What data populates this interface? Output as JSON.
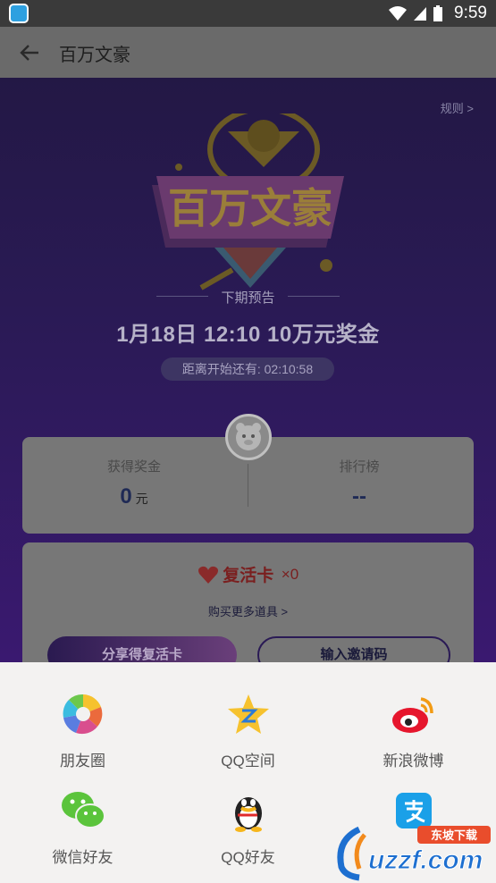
{
  "status_bar": {
    "time": "9:59",
    "icons": [
      "app-icon",
      "wifi-icon",
      "signal-icon",
      "battery-icon"
    ]
  },
  "app_bar": {
    "back_icon": "arrow-left-icon",
    "title": "百万文豪"
  },
  "hero": {
    "rules_link": "规则 >",
    "logo_text": "百万文豪",
    "next_label": "下期预告",
    "next_time": "1月18日 12:10 10万元奖金",
    "countdown": "距离开始还有: 02:10:58"
  },
  "stats": {
    "prize_label": "获得奖金",
    "prize_value": "0",
    "prize_unit": "元",
    "rank_label": "排行榜",
    "rank_value": "--"
  },
  "revive": {
    "label": "复活卡",
    "count": "×0",
    "buy_more": "购买更多道具 >",
    "share_button": "分享得复活卡",
    "invite_button": "输入邀请码"
  },
  "share_sheet": {
    "items": [
      {
        "label": "朋友圈",
        "icon": "moments-icon"
      },
      {
        "label": "QQ空间",
        "icon": "qzone-icon"
      },
      {
        "label": "新浪微博",
        "icon": "weibo-icon"
      },
      {
        "label": "微信好友",
        "icon": "wechat-icon"
      },
      {
        "label": "QQ好友",
        "icon": "qq-icon"
      },
      {
        "label": "",
        "icon": "alipay-icon"
      }
    ]
  },
  "watermark": {
    "text": "uzzf.com",
    "subtext": "东坡下载"
  },
  "colors": {
    "hero_top": "#231845",
    "hero_bottom": "#3a1970",
    "sheet_bg": "#f3f2f1",
    "heart": "#c23030"
  }
}
